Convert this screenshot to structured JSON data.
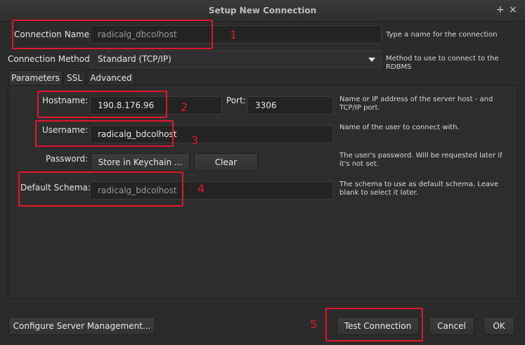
{
  "window": {
    "title": "Setup New Connection",
    "controls": [
      "+",
      "×"
    ]
  },
  "connection_name": {
    "label": "Connection Name:",
    "value": "radicalg_dbcolhost",
    "hint": "Type a name for the connection"
  },
  "connection_method": {
    "label": "Connection Method:",
    "value": "Standard (TCP/IP)",
    "hint": "Method to use to connect to the RDBMS"
  },
  "tabs": [
    {
      "label": "Parameters",
      "active": true
    },
    {
      "label": "SSL",
      "active": false
    },
    {
      "label": "Advanced",
      "active": false
    }
  ],
  "hostname": {
    "label": "Hostname:",
    "value": "190.8.176.96",
    "port_label": "Port:",
    "port_value": "3306",
    "hint": "Name or IP address of the server host - and TCP/IP port."
  },
  "username": {
    "label": "Username:",
    "value": "radicalg_bdcolhost",
    "hint": "Name of the user to connect with."
  },
  "password": {
    "label": "Password:",
    "store_button": "Store in Keychain ...",
    "clear_button": "Clear",
    "hint": "The user's password. Will be requested later if it's not set."
  },
  "default_schema": {
    "label": "Default Schema:",
    "value": "radicalg_bdcolhost",
    "hint": "The schema to use as default schema. Leave blank to select it later."
  },
  "footer": {
    "configure_button": "Configure Server Management...",
    "test_button": "Test Connection",
    "cancel_button": "Cancel",
    "ok_button": "OK"
  },
  "annotations": [
    "1",
    "2",
    "3",
    "4",
    "5"
  ],
  "colors": {
    "annotation": "#e3162b",
    "background": "#2b2b2b"
  }
}
